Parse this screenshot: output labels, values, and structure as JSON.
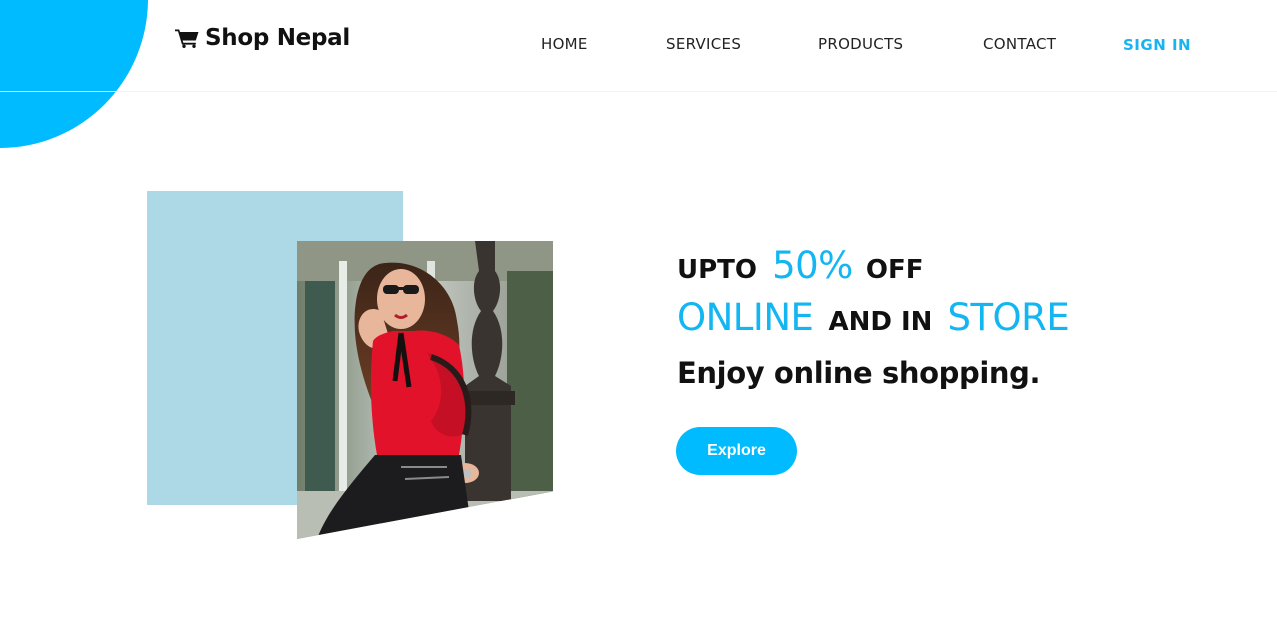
{
  "header": {
    "logo": {
      "icon": "cart-icon",
      "text": "Shop Nepal"
    },
    "nav": {
      "home": "HOME",
      "services": "SERVICES",
      "products": "PRODUCTS",
      "contact": "CONTACT",
      "sign_in": "SIGN IN"
    }
  },
  "hero": {
    "promo": {
      "line1_prefix": "UPTO",
      "line1_highlight": "50%",
      "line1_suffix": "OFF",
      "line2_highlight_a": "ONLINE",
      "line2_middle": "AND IN",
      "line2_highlight_b": "STORE",
      "line3": "Enjoy online shopping."
    },
    "cta_label": "Explore",
    "image": "fashion-model-photo"
  },
  "colors": {
    "accent": "#00bbff",
    "accent_text": "#14b6f2",
    "panel": "#add8e6",
    "text": "#111111",
    "background": "#ffffff"
  }
}
